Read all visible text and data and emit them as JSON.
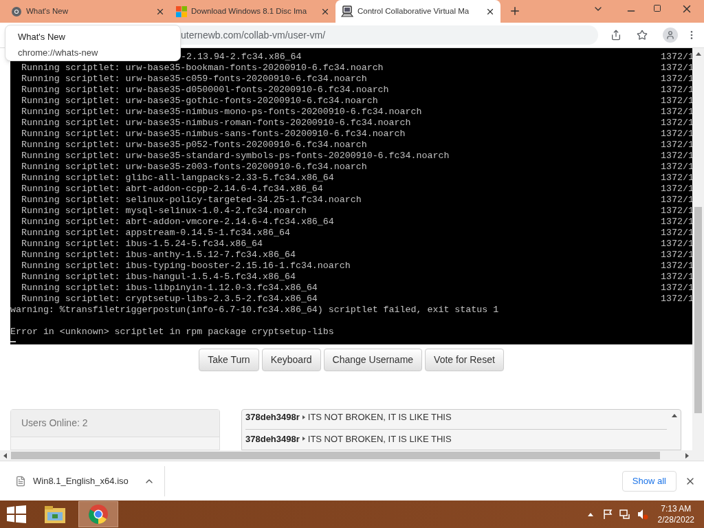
{
  "browser": {
    "tabs": [
      {
        "title": "What's New",
        "selected": false
      },
      {
        "title": "Download Windows 8.1 Disc Ima",
        "selected": false
      },
      {
        "title": "Control Collaborative Virtual Ma",
        "selected": true
      }
    ],
    "url": "uternewb.com/collab-vm/user-vm/",
    "tab_popup": {
      "title": "What's New",
      "url": "chrome://whats-new"
    }
  },
  "terminal": {
    "lines": [
      {
        "text": "-2.13.94-2.fc34.x86_64",
        "right": "1372/1",
        "kind": "partial"
      },
      {
        "text": "  Running scriptlet: urw-base35-bookman-fonts-20200910-6.fc34.noarch",
        "right": "1372/1"
      },
      {
        "text": "  Running scriptlet: urw-base35-c059-fonts-20200910-6.fc34.noarch",
        "right": "1372/1"
      },
      {
        "text": "  Running scriptlet: urw-base35-d050000l-fonts-20200910-6.fc34.noarch",
        "right": "1372/1"
      },
      {
        "text": "  Running scriptlet: urw-base35-gothic-fonts-20200910-6.fc34.noarch",
        "right": "1372/1"
      },
      {
        "text": "  Running scriptlet: urw-base35-nimbus-mono-ps-fonts-20200910-6.fc34.noarch",
        "right": "1372/1"
      },
      {
        "text": "  Running scriptlet: urw-base35-nimbus-roman-fonts-20200910-6.fc34.noarch",
        "right": "1372/1"
      },
      {
        "text": "  Running scriptlet: urw-base35-nimbus-sans-fonts-20200910-6.fc34.noarch",
        "right": "1372/1"
      },
      {
        "text": "  Running scriptlet: urw-base35-p052-fonts-20200910-6.fc34.noarch",
        "right": "1372/1"
      },
      {
        "text": "  Running scriptlet: urw-base35-standard-symbols-ps-fonts-20200910-6.fc34.noarch",
        "right": "1372/1"
      },
      {
        "text": "  Running scriptlet: urw-base35-z003-fonts-20200910-6.fc34.noarch",
        "right": "1372/1"
      },
      {
        "text": "  Running scriptlet: glibc-all-langpacks-2.33-5.fc34.x86_64",
        "right": "1372/1"
      },
      {
        "text": "  Running scriptlet: abrt-addon-ccpp-2.14.6-4.fc34.x86_64",
        "right": "1372/1"
      },
      {
        "text": "  Running scriptlet: selinux-policy-targeted-34.25-1.fc34.noarch",
        "right": "1372/1"
      },
      {
        "text": "  Running scriptlet: mysql-selinux-1.0.4-2.fc34.noarch",
        "right": "1372/1"
      },
      {
        "text": "  Running scriptlet: abrt-addon-vmcore-2.14.6-4.fc34.x86_64",
        "right": "1372/1"
      },
      {
        "text": "  Running scriptlet: appstream-0.14.5-1.fc34.x86_64",
        "right": "1372/1"
      },
      {
        "text": "  Running scriptlet: ibus-1.5.24-5.fc34.x86_64",
        "right": "1372/1"
      },
      {
        "text": "  Running scriptlet: ibus-anthy-1.5.12-7.fc34.x86_64",
        "right": "1372/1"
      },
      {
        "text": "  Running scriptlet: ibus-typing-booster-2.15.16-1.fc34.noarch",
        "right": "1372/1"
      },
      {
        "text": "  Running scriptlet: ibus-hangul-1.5.4-5.fc34.x86_64",
        "right": "1372/1"
      },
      {
        "text": "  Running scriptlet: ibus-libpinyin-1.12.0-3.fc34.x86_64",
        "right": "1372/1"
      },
      {
        "text": "  Running scriptlet: cryptsetup-libs-2.3.5-2.fc34.x86_64",
        "right": "1372/1"
      },
      {
        "text": "warning: %transfiletriggerpostun(info-6.7-10.fc34.x86_64) scriptlet failed, exit status 1",
        "kind": "message"
      },
      {
        "text": "Error in <unknown> scriptlet in rpm package cryptsetup-libs",
        "kind": "error"
      }
    ]
  },
  "controls": [
    "Take Turn",
    "Keyboard",
    "Change Username",
    "Vote for Reset"
  ],
  "users_panel": {
    "title": "Users Online: 2"
  },
  "chat": [
    {
      "user": "378deh3498r",
      "message": "ITS NOT BROKEN, IT IS LIKE THIS"
    },
    {
      "user": "378deh3498r",
      "message": "ITS NOT BROKEN, IT IS LIKE THIS"
    }
  ],
  "downloads": {
    "file": "Win8.1_English_x64.iso",
    "show_all": "Show all"
  },
  "taskbar": {
    "time": "7:13 AM",
    "date": "2/28/2022"
  }
}
